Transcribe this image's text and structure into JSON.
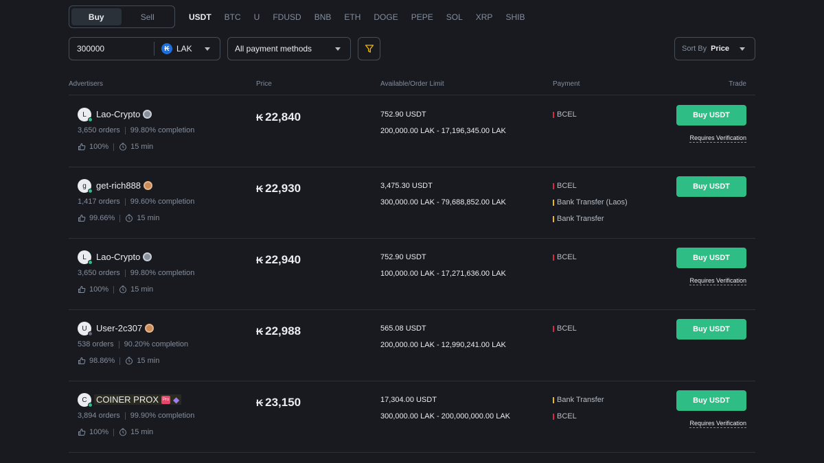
{
  "trade_toggle": {
    "buy": "Buy",
    "sell": "Sell",
    "active": "buy"
  },
  "coins": [
    "USDT",
    "BTC",
    "U",
    "FDUSD",
    "BNB",
    "ETH",
    "DOGE",
    "PEPE",
    "SOL",
    "XRP",
    "SHIB"
  ],
  "active_coin": "USDT",
  "filters": {
    "amount": "300000",
    "currency_symbol": "₭",
    "currency": "LAK",
    "payment_methods": "All payment methods",
    "sort_label": "Sort By",
    "sort_value": "Price"
  },
  "table_headers": {
    "advertisers": "Advertisers",
    "price": "Price",
    "available": "Available/Order Limit",
    "payment": "Payment",
    "trade": "Trade"
  },
  "colors": {
    "accent_green": "#2ebd85",
    "bcel": "#e0243a",
    "bank_transfer": "#f0b90b",
    "background": "#181a20"
  },
  "rows": [
    {
      "avatar_letter": "L",
      "online": true,
      "name": "Lao-Crypto",
      "badge": "silver-medal",
      "orders": "3,650 orders",
      "completion": "99.80% completion",
      "rating": "100%",
      "time": "15 min",
      "price_symbol": "₭",
      "price": "22,840",
      "available": "752.90 USDT",
      "limit": "200,000.00 LAK - 17,196,345.00 LAK",
      "payments": [
        {
          "name": "BCEL",
          "color": "#e0243a"
        }
      ],
      "button": "Buy USDT",
      "requires_verification": "Requires Verification"
    },
    {
      "avatar_letter": "g",
      "online": true,
      "name": "get-rich888",
      "badge": "bronze-medal",
      "orders": "1,417 orders",
      "completion": "99.60% completion",
      "rating": "99.66%",
      "time": "15 min",
      "price_symbol": "₭",
      "price": "22,930",
      "available": "3,475.30 USDT",
      "limit": "300,000.00 LAK - 79,688,852.00 LAK",
      "payments": [
        {
          "name": "BCEL",
          "color": "#e0243a"
        },
        {
          "name": "Bank Transfer (Laos)",
          "color": "#f0b90b"
        },
        {
          "name": "Bank Transfer",
          "color": "#f0b90b"
        }
      ],
      "button": "Buy USDT",
      "requires_verification": ""
    },
    {
      "avatar_letter": "L",
      "online": true,
      "name": "Lao-Crypto",
      "badge": "silver-medal",
      "orders": "3,650 orders",
      "completion": "99.80% completion",
      "rating": "100%",
      "time": "15 min",
      "price_symbol": "₭",
      "price": "22,940",
      "available": "752.90 USDT",
      "limit": "100,000.00 LAK - 17,271,636.00 LAK",
      "payments": [
        {
          "name": "BCEL",
          "color": "#e0243a"
        }
      ],
      "button": "Buy USDT",
      "requires_verification": "Requires Verification"
    },
    {
      "avatar_letter": "U",
      "online": false,
      "name": "User-2c307",
      "badge": "bronze-medal",
      "orders": "538 orders",
      "completion": "90.20% completion",
      "rating": "98.86%",
      "time": "15 min",
      "price_symbol": "₭",
      "price": "22,988",
      "available": "565.08 USDT",
      "limit": "200,000.00 LAK - 12,990,241.00 LAK",
      "payments": [
        {
          "name": "BCEL",
          "color": "#e0243a"
        }
      ],
      "button": "Buy USDT",
      "requires_verification": ""
    },
    {
      "avatar_letter": "C",
      "online": true,
      "name": "COINER PROX",
      "badge": "pro-diamond",
      "orders": "3,894 orders",
      "completion": "99.90% completion",
      "rating": "100%",
      "time": "15 min",
      "price_symbol": "₭",
      "price": "23,150",
      "available": "17,304.00 USDT",
      "limit": "300,000.00 LAK - 200,000,000.00 LAK",
      "payments": [
        {
          "name": "Bank Transfer",
          "color": "#f0b90b"
        },
        {
          "name": "BCEL",
          "color": "#e0243a"
        }
      ],
      "button": "Buy USDT",
      "requires_verification": "Requires Verification"
    }
  ]
}
